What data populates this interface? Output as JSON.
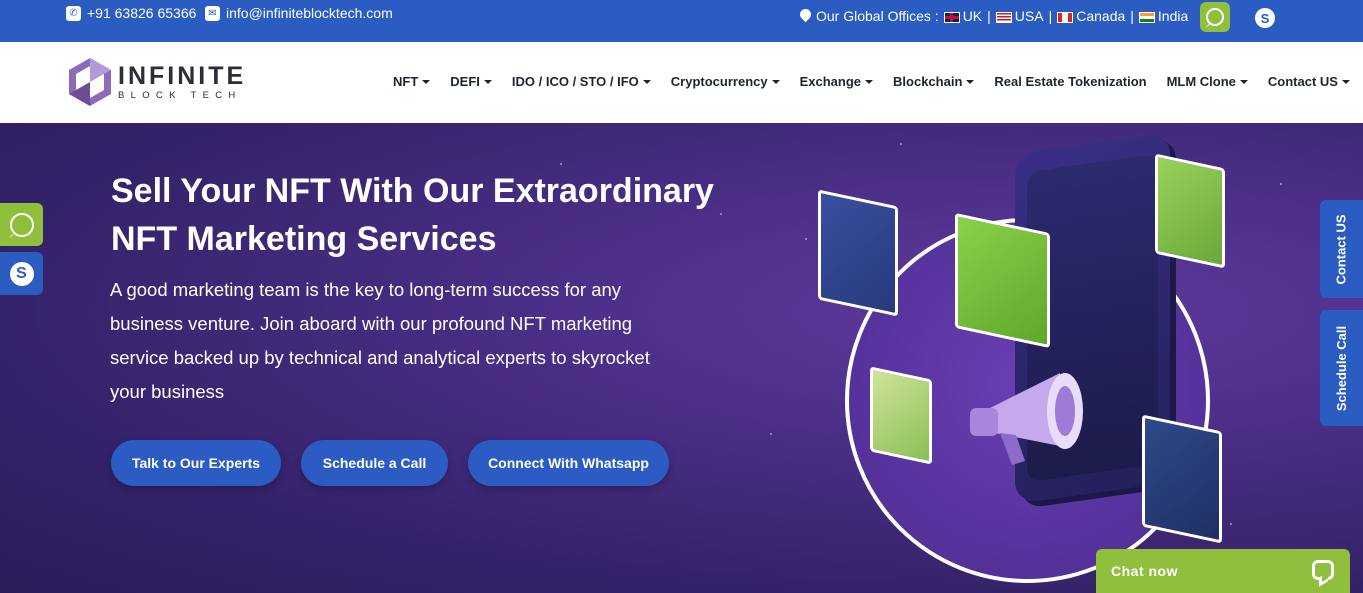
{
  "topbar": {
    "phone": "+91 63826 65366",
    "email": "info@infiniteblocktech.com",
    "offices_label": "Our Global Offices :",
    "offices": [
      {
        "name": "UK",
        "flag": "uk-flag-icon"
      },
      {
        "name": "USA",
        "flag": "us-flag-icon"
      },
      {
        "name": "Canada",
        "flag": "ca-flag-icon"
      },
      {
        "name": "India",
        "flag": "in-flag-icon"
      }
    ],
    "separator": "|"
  },
  "logo": {
    "main": "INFINITE",
    "sub": "BLOCK TECH"
  },
  "nav": {
    "items": [
      {
        "label": "NFT",
        "dropdown": true
      },
      {
        "label": "DEFI",
        "dropdown": true
      },
      {
        "label": "IDO / ICO / STO / IFO",
        "dropdown": true
      },
      {
        "label": "Cryptocurrency",
        "dropdown": true
      },
      {
        "label": "Exchange",
        "dropdown": true
      },
      {
        "label": "Blockchain",
        "dropdown": true
      },
      {
        "label": "Real Estate Tokenization",
        "dropdown": false
      },
      {
        "label": "MLM Clone",
        "dropdown": true
      },
      {
        "label": "Contact US",
        "dropdown": true
      }
    ]
  },
  "hero": {
    "title_line1": "Sell Your NFT With Our Extraordinary",
    "title_line2": "NFT Marketing Services",
    "description": "A good marketing team is the key to long-term success for any business venture. Join aboard with our profound NFT marketing service backed up by technical and analytical experts to skyrocket your business",
    "buttons": {
      "talk": "Talk to Our Experts",
      "schedule": "Schedule a Call",
      "whatsapp": "Connect With Whatsapp"
    }
  },
  "side_tabs": {
    "contact": "Contact US",
    "schedule": "Schedule Call"
  },
  "chat": {
    "label": "Chat now"
  },
  "colors": {
    "brand_blue": "#2b5cc2",
    "whatsapp_green": "#8fbf3d",
    "hero_purple": "#4a2e86"
  }
}
